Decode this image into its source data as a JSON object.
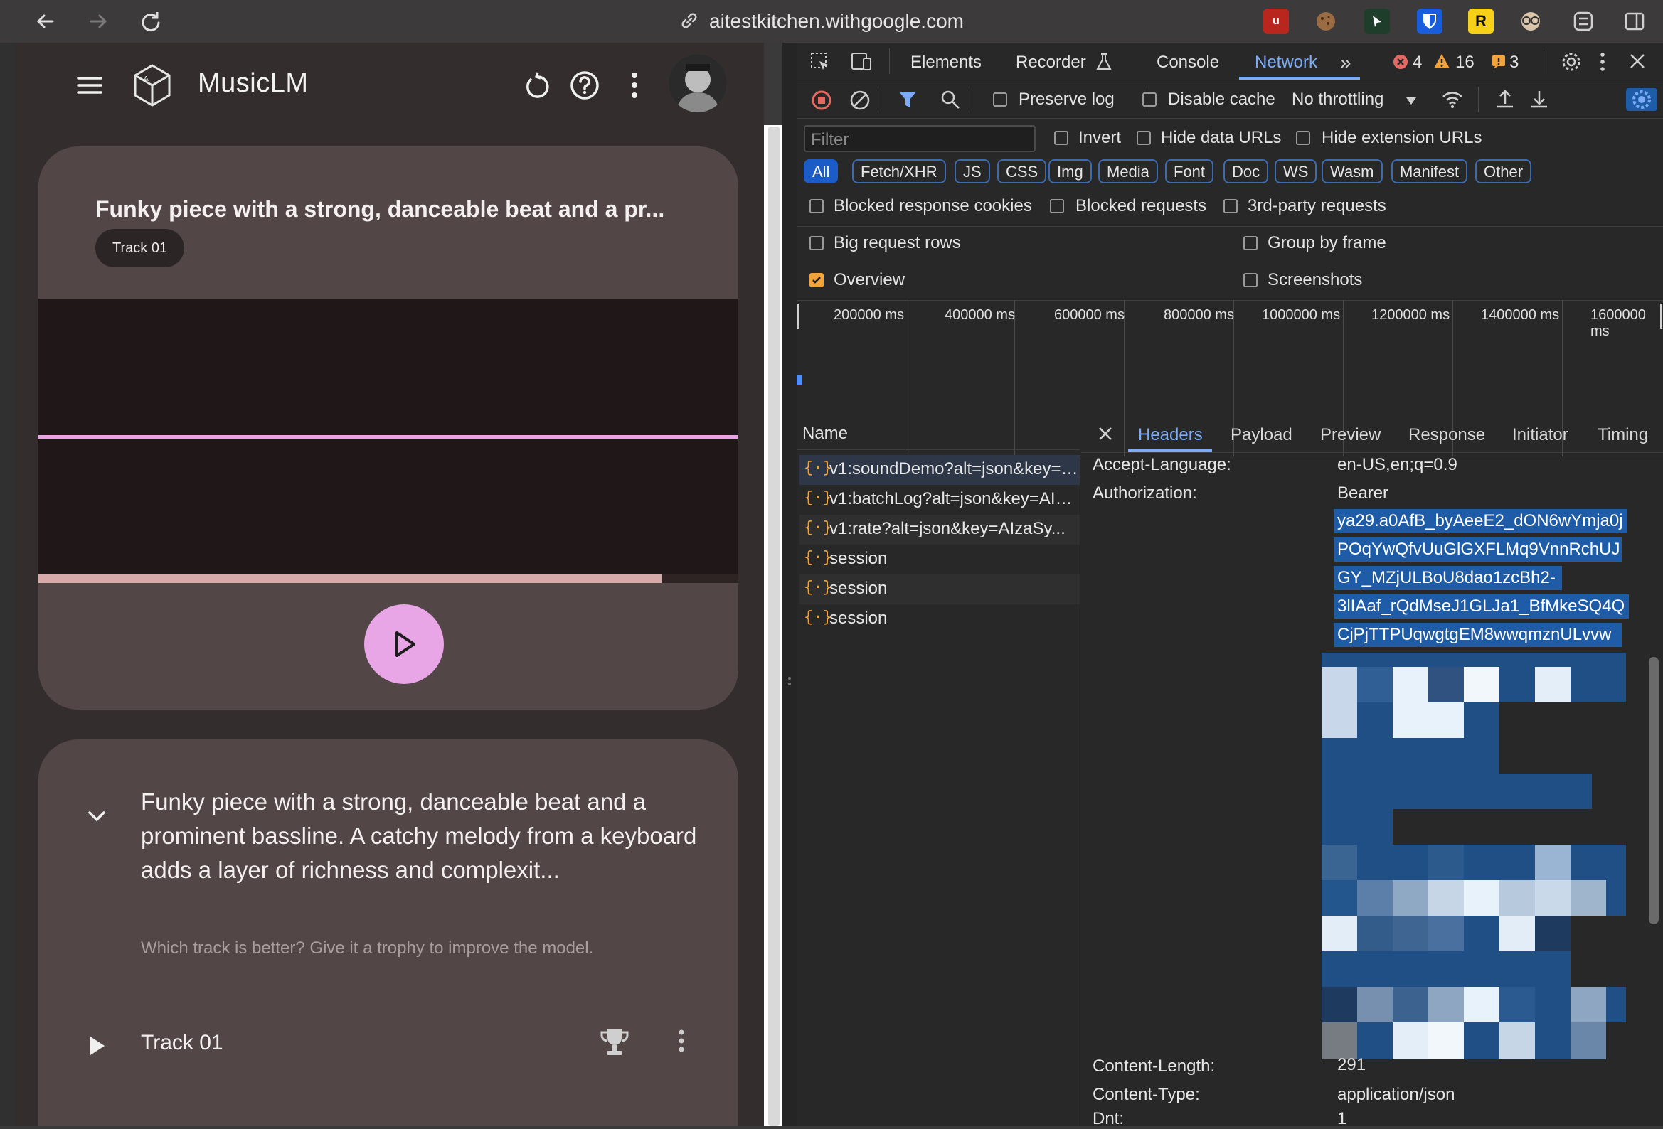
{
  "browser": {
    "url": "aitestkitchen.withgoogle.com",
    "extensions": [
      "ublock-icon",
      "cookie-icon",
      "cursor-extension-icon",
      "bitwarden-icon",
      "readwise-icon",
      "glasses-icon",
      "extension-puzzle-icon",
      "sidebar-toggle-icon"
    ]
  },
  "app": {
    "title": "MusicLM",
    "card1": {
      "prompt_truncated": "Funky piece with a strong, danceable beat and a pr...",
      "chip": "Track 01",
      "progress": 0.89
    },
    "card2": {
      "prompt": "Funky piece with a strong, danceable beat and a prominent bassline. A catchy melody from a keyboard adds a layer of richness and complexit...",
      "hint": "Which track is better? Give it a trophy to improve the model.",
      "track_label": "Track 01"
    }
  },
  "devtools": {
    "tabs": [
      "Elements",
      "Recorder",
      "Console",
      "Network"
    ],
    "active_tab": "Network",
    "errors": "4",
    "warnings": "16",
    "issues": "3",
    "toolbar": {
      "preserve_log": "Preserve log",
      "disable_cache": "Disable cache",
      "throttling": "No throttling"
    },
    "filter": {
      "placeholder": "Filter",
      "invert": "Invert",
      "hide_data_urls": "Hide data URLs",
      "hide_extension_urls": "Hide extension URLs",
      "types": [
        "All",
        "Fetch/XHR",
        "JS",
        "CSS",
        "Img",
        "Media",
        "Font",
        "Doc",
        "WS",
        "Wasm",
        "Manifest",
        "Other"
      ],
      "blocked_cookies": "Blocked response cookies",
      "blocked_requests": "Blocked requests",
      "third_party": "3rd-party requests"
    },
    "options": {
      "big_rows": "Big request rows",
      "group_by_frame": "Group by frame",
      "overview": "Overview",
      "screenshots": "Screenshots"
    },
    "timeline_ticks": [
      "200000 ms",
      "400000 ms",
      "600000 ms",
      "800000 ms",
      "1000000 ms",
      "1200000 ms",
      "1400000 ms",
      "1600000 ms"
    ],
    "name_header": "Name",
    "requests": [
      "v1:soundDemo?alt=json&key=AIzaSy...",
      "v1:batchLog?alt=json&key=AIzaSy...",
      "v1:rate?alt=json&key=AIzaSy...",
      "session",
      "session",
      "session"
    ],
    "detail_tabs": [
      "Headers",
      "Payload",
      "Preview",
      "Response",
      "Initiator",
      "Timing"
    ],
    "headers": {
      "accept_language_key": "Accept-Language:",
      "accept_language_val": "en-US,en;q=0.9",
      "authorization_key": "Authorization:",
      "authorization_val": "Bearer",
      "token_lines": [
        "ya29.a0AfB_byAeeE2_dON6wYmja0j",
        "POqYwQfvUuGlGXFLMq9VnnRchUJ",
        "GY_MZjULBoU8dao1zcBh2-",
        "3lIAaf_rQdMseJ1GLJa1_BfMkeSQ4Q",
        "CjPjTTPUqwgtgEM8wwqmznULvvw"
      ],
      "content_length_key": "Content-Length:",
      "content_length_val": "291",
      "content_type_key": "Content-Type:",
      "content_type_val": "application/json",
      "dnt_key": "Dnt:",
      "dnt_val": "1"
    }
  }
}
